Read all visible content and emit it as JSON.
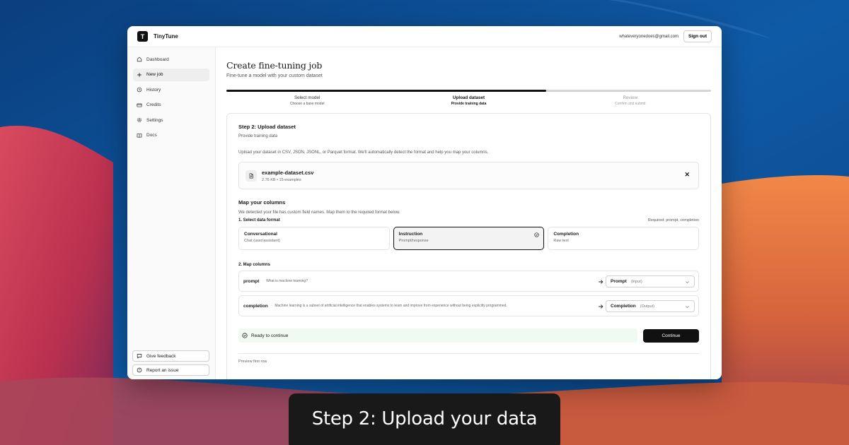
{
  "app": {
    "name": "TinyTune",
    "logo_letter": "T",
    "user_email": "whateveryonedoes@gmail.com",
    "signout_label": "Sign out"
  },
  "sidebar": {
    "items": [
      {
        "label": "Dashboard",
        "icon": "home-icon"
      },
      {
        "label": "New job",
        "icon": "plus-icon",
        "active": true
      },
      {
        "label": "History",
        "icon": "history-icon"
      },
      {
        "label": "Credits",
        "icon": "credit-card-icon"
      },
      {
        "label": "Settings",
        "icon": "gear-icon"
      },
      {
        "label": "Docs",
        "icon": "book-icon"
      }
    ],
    "feedback_label": "Give feedback",
    "report_label": "Report an issue"
  },
  "page": {
    "title": "Create fine-tuning job",
    "subtitle": "Fine-tune a model with your custom dataset"
  },
  "stepper": {
    "progress": 0.66,
    "steps": [
      {
        "title": "Select model",
        "subtitle": "Choose a base model",
        "state": "done"
      },
      {
        "title": "Upload dataset",
        "subtitle": "Provide training data",
        "state": "current"
      },
      {
        "title": "Review",
        "subtitle": "Confirm and submit",
        "state": "future"
      }
    ]
  },
  "card": {
    "title": "Step 2: Upload dataset",
    "subtitle": "Provide training data",
    "description": "Upload your dataset in CSV, JSON, JSONL, or Parquet format. We'll automatically detect the format and help you map your columns."
  },
  "file": {
    "name": "example-dataset.csv",
    "meta": "2.76 KB • 15 examples",
    "remove_glyph": "✕",
    "icon": "file-icon"
  },
  "mapping": {
    "title": "Map your columns",
    "description": "We detected your file has custom field names. Map them to the required format below.",
    "format_heading": "1. Select data format",
    "required_note": "Required: prompt, completion",
    "formats": [
      {
        "name": "Conversational",
        "desc": "Chat (user/assistant)",
        "selected": false
      },
      {
        "name": "Instruction",
        "desc": "Prompt/response",
        "selected": true
      },
      {
        "name": "Completion",
        "desc": "Raw text",
        "selected": false
      }
    ],
    "columns_heading": "2. Map columns",
    "columns": [
      {
        "field": "prompt",
        "sample": "What is machine learning?",
        "target": "Prompt",
        "hint": "(Input)"
      },
      {
        "field": "completion",
        "sample": "Machine learning is a subset of artificial intelligence that enables systems to learn and improve from experience without being explicitly programmed.",
        "target": "Completion",
        "hint": "(Output)"
      }
    ],
    "separator": "·"
  },
  "status": {
    "ready_label": "Ready to continue",
    "continue_label": "Continue",
    "preview_label": "Preview first row"
  },
  "caption": {
    "text": "Step 2: Upload your data"
  },
  "colors": {
    "accent": "#111111",
    "ready_bg": "#effaf3",
    "wallpaper_blue": "#0d4a8c",
    "wallpaper_red": "#c23a52",
    "wallpaper_orange": "#d86a3a"
  }
}
